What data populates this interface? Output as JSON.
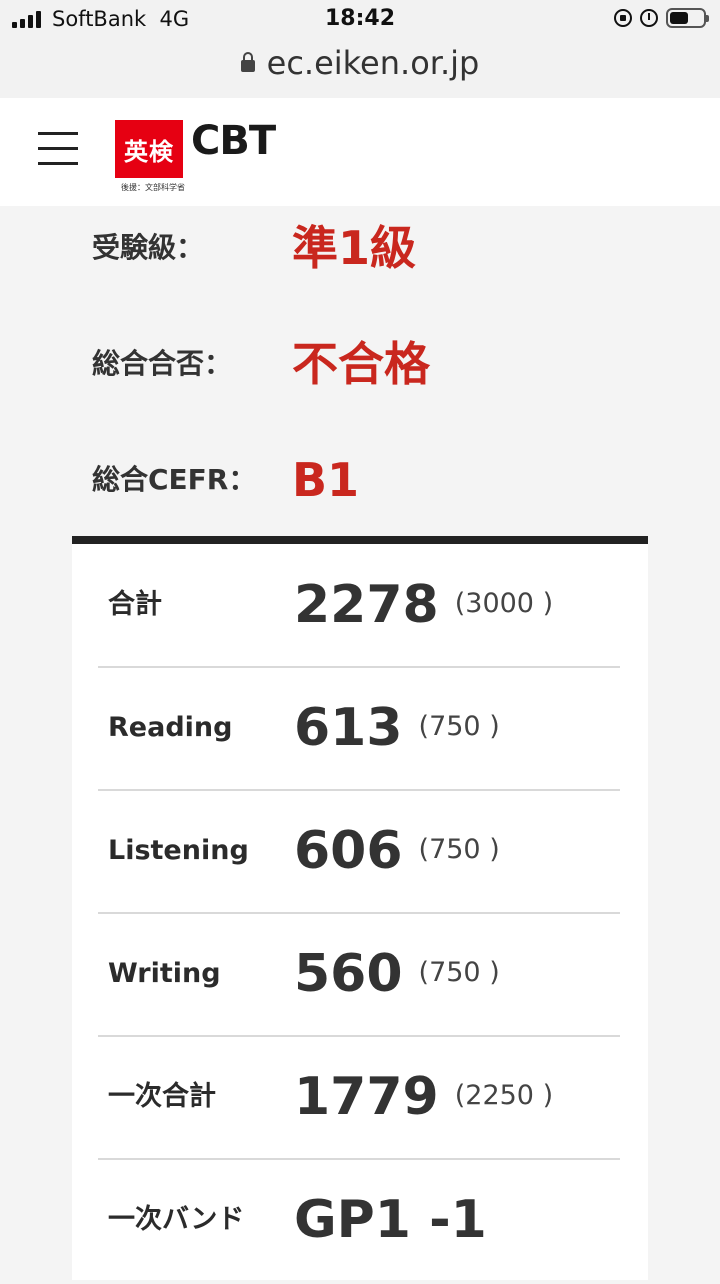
{
  "status_bar": {
    "carrier": "SoftBank",
    "network": "4G",
    "time": "18:42",
    "battery_level": 0.55
  },
  "browser": {
    "url": "ec.eiken.or.jp"
  },
  "header": {
    "logo_mark": "英検",
    "logo_text": "CBT",
    "logo_sub": "後援：文部科学省"
  },
  "summary": [
    {
      "label": "受験級：",
      "value": "準1級"
    },
    {
      "label": "総合合否：",
      "value": "不合格"
    },
    {
      "label": "総合CEFR：",
      "value": "B1"
    }
  ],
  "scores": [
    {
      "label": "合計",
      "value": "2278",
      "max": "(3000 )"
    },
    {
      "label": "Reading",
      "value": "613",
      "max": "(750 )"
    },
    {
      "label": "Listening",
      "value": "606",
      "max": "(750 )"
    },
    {
      "label": "Writing",
      "value": "560",
      "max": "(750 )"
    },
    {
      "label": "一次合計",
      "value": "1779",
      "max": "(2250 )"
    },
    {
      "label": "一次バンド",
      "value": "GP1 -1",
      "max": ""
    }
  ]
}
